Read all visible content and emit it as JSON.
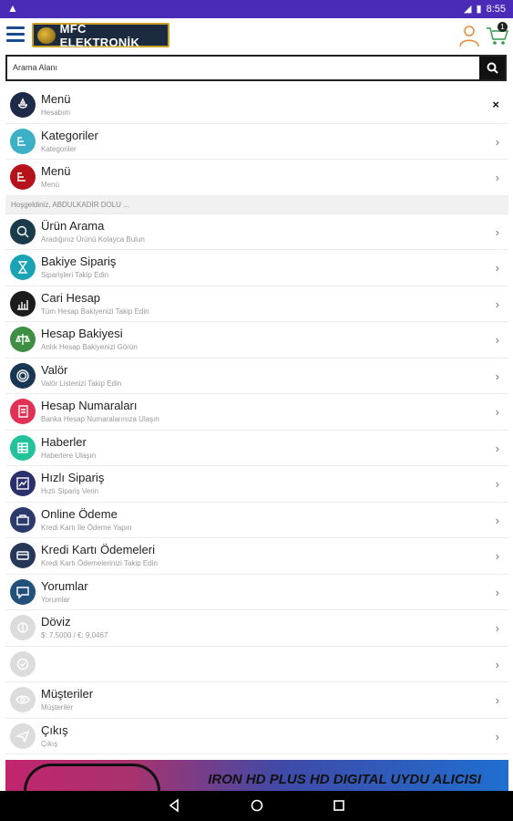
{
  "status_bar": {
    "time": "8:55",
    "cart_count": "1"
  },
  "header": {
    "logo_text": "MFC ELEKTRONİK"
  },
  "search": {
    "placeholder": "Arama Alanı"
  },
  "menu_top": [
    {
      "title": "Menü",
      "sub": "Hesabım",
      "icon": "ship-wheel-icon",
      "color": "#1e2b48",
      "action": "×"
    },
    {
      "title": "Kategoriler",
      "sub": "Kategoriler",
      "icon": "list-icon",
      "color": "#3bb0c6",
      "action": "›"
    },
    {
      "title": "Menü",
      "sub": "Menü",
      "icon": "list-icon",
      "color": "#b5121b",
      "action": "›"
    }
  ],
  "greeting": "Hoşgeldiniz, ABDULKADİR DOLU ...",
  "menu_items": [
    {
      "title": "Ürün Arama",
      "sub": "Aradığınız Ürünü Kolayca Bulun",
      "icon": "search-icon",
      "color": "#1b3a4b"
    },
    {
      "title": "Bakiye Sipariş",
      "sub": "Siparişleri Takip Edin",
      "icon": "hourglass-icon",
      "color": "#1aa3b5"
    },
    {
      "title": "Cari Hesap",
      "sub": "Tüm Hesap Bakiyenizi Takip Edin",
      "icon": "chart-icon",
      "color": "#1c1c1c"
    },
    {
      "title": "Hesap Bakiyesi",
      "sub": "Anlık Hesap Bakiyenizi Görün",
      "icon": "scale-icon",
      "color": "#3e8f44"
    },
    {
      "title": "Valör",
      "sub": "Valör Listenizi Takip Edin",
      "icon": "coin-icon",
      "color": "#173752"
    },
    {
      "title": "Hesap Numaraları",
      "sub": "Banka Hesap Numaralarınıza Ulaşın",
      "icon": "book-icon",
      "color": "#e03155"
    },
    {
      "title": "Haberler",
      "sub": "Haberlere Ulaşın",
      "icon": "table-icon",
      "color": "#22c39a"
    },
    {
      "title": "Hızlı Sipariş",
      "sub": "Hızlı Sipariş Verin",
      "icon": "trend-icon",
      "color": "#2b2f6b"
    },
    {
      "title": "Online Ödeme",
      "sub": "Kredi Kartı İle Ödeme Yapın",
      "icon": "cash-icon",
      "color": "#2b3a6b"
    },
    {
      "title": "Kredi Kartı Ödemeleri",
      "sub": "Kredi Kartı Ödemelerinizi Takip Edin",
      "icon": "card-payment-icon",
      "color": "#263758"
    },
    {
      "title": "Yorumlar",
      "sub": "Yorumlar",
      "icon": "comment-icon",
      "color": "#22507a"
    },
    {
      "title": "Döviz",
      "sub": "$: 7,5000 / €: 9,0467",
      "icon": "currency-icon",
      "color": "#dcdcdc"
    },
    {
      "title": "",
      "sub": "",
      "icon": "check-icon",
      "color": "#dcdcdc"
    },
    {
      "title": "Müşteriler",
      "sub": "Müşteriler",
      "icon": "eye-icon",
      "color": "#dcdcdc"
    },
    {
      "title": "Çıkış",
      "sub": "Çıkış",
      "icon": "send-icon",
      "color": "#dcdcdc"
    }
  ],
  "banner": {
    "text": "IRON HD PLUS HD DIGITAL UYDU ALICISI"
  }
}
